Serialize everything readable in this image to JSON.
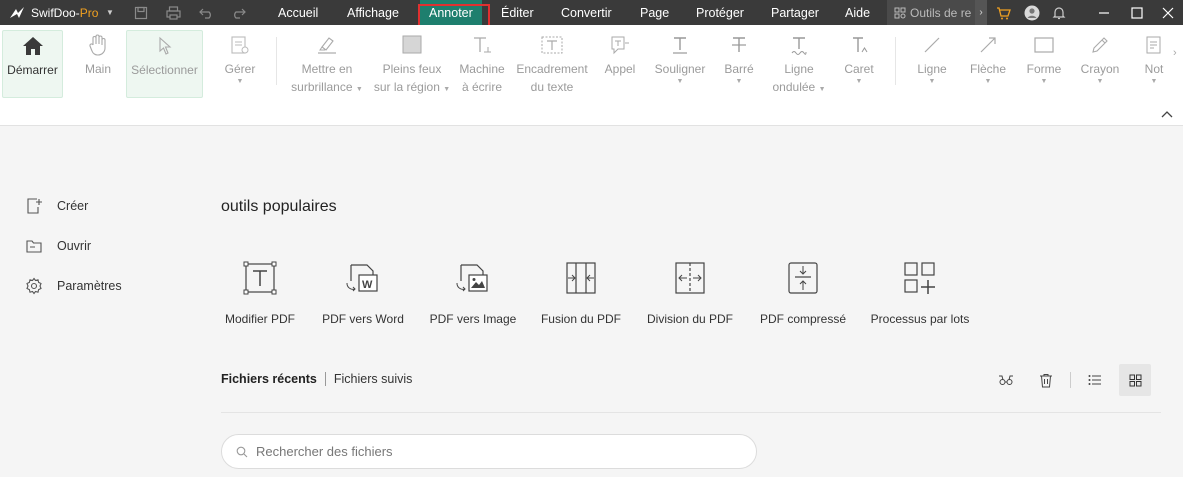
{
  "app": {
    "name": "SwifDoo-",
    "edition": "Pro"
  },
  "menu": [
    {
      "label": "Accueil",
      "active": false
    },
    {
      "label": "Affichage",
      "active": false
    },
    {
      "label": "Annoter",
      "active": true
    },
    {
      "label": "Éditer",
      "active": false
    },
    {
      "label": "Convertir",
      "active": false
    },
    {
      "label": "Page",
      "active": false
    },
    {
      "label": "Protéger",
      "active": false
    },
    {
      "label": "Partager",
      "active": false
    },
    {
      "label": "Aide",
      "active": false
    }
  ],
  "tools_search": {
    "text": "Outils de re"
  },
  "ribbon": {
    "tools": [
      {
        "line1": "Démarrer",
        "line2": "",
        "icon": "home-icon"
      },
      {
        "line1": "Main",
        "line2": "",
        "icon": "hand-icon"
      },
      {
        "line1": "Sélectionner",
        "line2": "",
        "icon": "cursor-icon"
      },
      {
        "line1": "Gérer",
        "line2": "",
        "icon": "manage-icon"
      },
      {
        "line1": "Mettre en",
        "line2": "surbrillance",
        "icon": "highlighter-icon"
      },
      {
        "line1": "Pleins feux",
        "line2": "sur la région",
        "icon": "area-highlight-icon"
      },
      {
        "line1": "Machine",
        "line2": "à écrire",
        "icon": "typewriter-icon"
      },
      {
        "line1": "Encadrement",
        "line2": "du texte",
        "icon": "textbox-icon"
      },
      {
        "line1": "Appel",
        "line2": "",
        "icon": "callout-icon"
      },
      {
        "line1": "Souligner",
        "line2": "",
        "icon": "underline-icon"
      },
      {
        "line1": "Barré",
        "line2": "",
        "icon": "strikethrough-icon"
      },
      {
        "line1": "Ligne",
        "line2": "ondulée",
        "icon": "squiggly-icon"
      },
      {
        "line1": "Caret",
        "line2": "",
        "icon": "caret-icon"
      },
      {
        "line1": "Ligne",
        "line2": "",
        "icon": "line-icon"
      },
      {
        "line1": "Flèche",
        "line2": "",
        "icon": "arrow-icon"
      },
      {
        "line1": "Forme",
        "line2": "",
        "icon": "shape-icon"
      },
      {
        "line1": "Crayon",
        "line2": "",
        "icon": "pencil-icon"
      },
      {
        "line1": "Not",
        "line2": "",
        "icon": "note-icon"
      }
    ]
  },
  "sidebar": {
    "items": [
      {
        "label": "Créer",
        "icon": "create-icon"
      },
      {
        "label": "Ouvrir",
        "icon": "folder-icon"
      },
      {
        "label": "Paramètres",
        "icon": "gear-icon"
      }
    ]
  },
  "main": {
    "section_title": "outils populaires",
    "popular_tools": [
      {
        "label": "Modifier PDF",
        "icon": "edit-pdf-icon"
      },
      {
        "label": "PDF vers Word",
        "icon": "pdf-to-word-icon"
      },
      {
        "label": "PDF vers Image",
        "icon": "pdf-to-image-icon"
      },
      {
        "label": "Fusion du PDF",
        "icon": "merge-pdf-icon"
      },
      {
        "label": "Division du PDF",
        "icon": "split-pdf-icon"
      },
      {
        "label": "PDF compressé",
        "icon": "compress-pdf-icon"
      },
      {
        "label": "Processus par lots",
        "icon": "batch-icon"
      }
    ],
    "tabs": {
      "recent": "Fichiers récents",
      "followed": "Fichiers suivis"
    },
    "search_placeholder": "Rechercher des fichiers"
  },
  "colors": {
    "titlebar": "#3a3a3a",
    "accent": "#1e7f6e",
    "highlight_box": "#e03030",
    "brand": "#f0a020"
  }
}
